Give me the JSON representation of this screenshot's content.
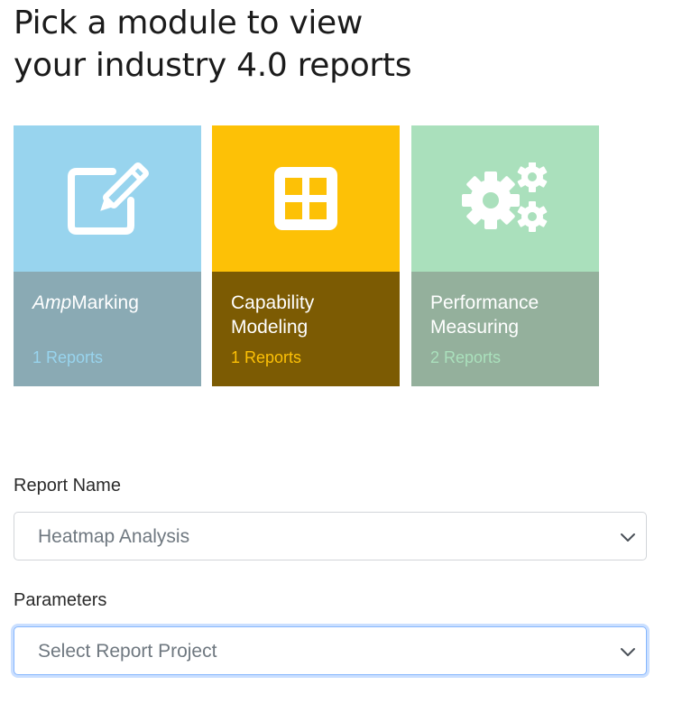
{
  "heading": {
    "line1": "Pick a module to view",
    "line2": "your industry 4.0 reports"
  },
  "modules": [
    {
      "name_prefix": "Amp",
      "name_suffix": "Marking",
      "reports": "1 Reports",
      "icon": "edit-square-icon",
      "color": "#98d4ee"
    },
    {
      "name": "Capability Modeling",
      "reports": "1 Reports",
      "icon": "grid-icon",
      "color": "#fdc106"
    },
    {
      "name": "Performance Measuring",
      "reports": "2 Reports",
      "icon": "gears-icon",
      "color": "#aae0bc"
    }
  ],
  "report_name": {
    "label": "Report Name",
    "value": "Heatmap Analysis"
  },
  "parameters": {
    "label": "Parameters",
    "placeholder": "Select Report Project"
  }
}
